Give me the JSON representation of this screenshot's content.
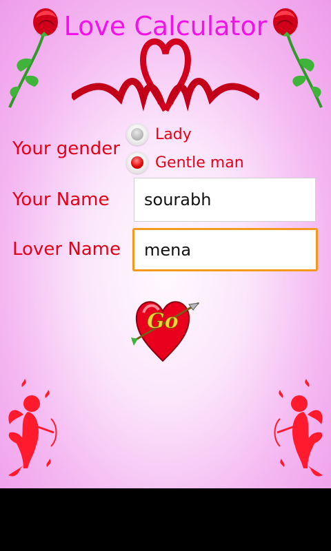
{
  "app": {
    "title": "Love Calculator"
  },
  "form": {
    "gender_label": "Your gender",
    "gender_options": [
      {
        "label": "Lady",
        "selected": false
      },
      {
        "label": "Gentle man",
        "selected": true
      }
    ],
    "name_label": "Your Name",
    "name_value": "sourabh",
    "lover_label": "Lover Name",
    "lover_value": "mena"
  },
  "go_button": {
    "label": "Go"
  },
  "colors": {
    "title": "#f012e6",
    "labels": "#e2001a",
    "focus_border": "#f39a1e",
    "background": "#f4b6f1"
  },
  "icons": [
    "rose-icon",
    "heart-ribbon-icon",
    "heart-arrow-icon",
    "cupid-icon"
  ]
}
